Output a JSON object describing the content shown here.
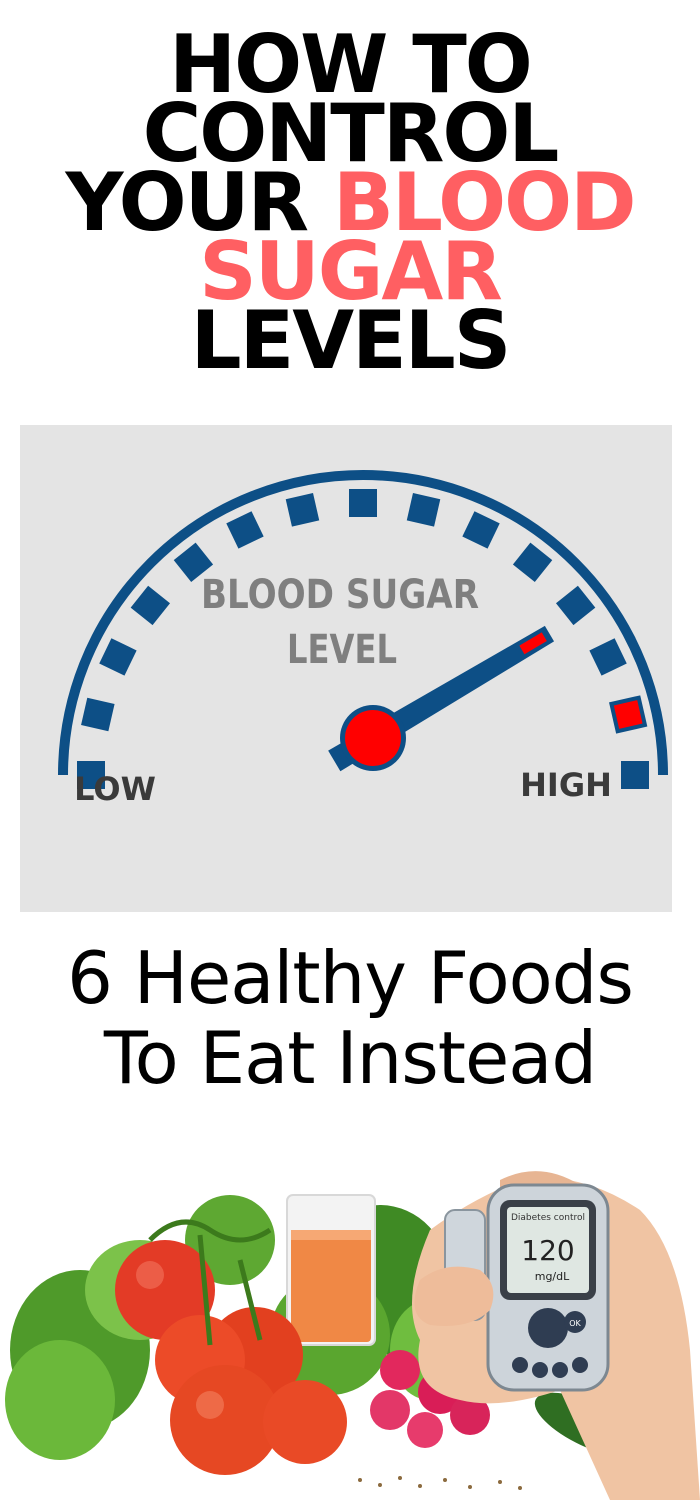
{
  "headline": {
    "line1": "HOW TO",
    "line2": "CONTROL",
    "line3_black": "YOUR ",
    "line3_accent": "BLOOD",
    "line4_accent": "SUGAR",
    "line5": "LEVELS"
  },
  "gauge": {
    "title_line1": "BLOOD SUGAR",
    "title_line2": "LEVEL",
    "low_label": "LOW",
    "high_label": "HIGH",
    "level_fraction": 0.83,
    "colors": {
      "background": "#e4e4e4",
      "arc": "#0d4f86",
      "danger": "#ff0000",
      "title": "#7f7f7f",
      "labels": "#3a3a3a"
    }
  },
  "subhead": {
    "line1": "6 Healthy Foods",
    "line2": "To Eat Instead"
  },
  "photo": {
    "meter_brand": "Diabetes control",
    "meter_value": "120",
    "meter_unit": "mg/dL",
    "meter_button": "OK"
  },
  "accent_color": "#ff5f62"
}
